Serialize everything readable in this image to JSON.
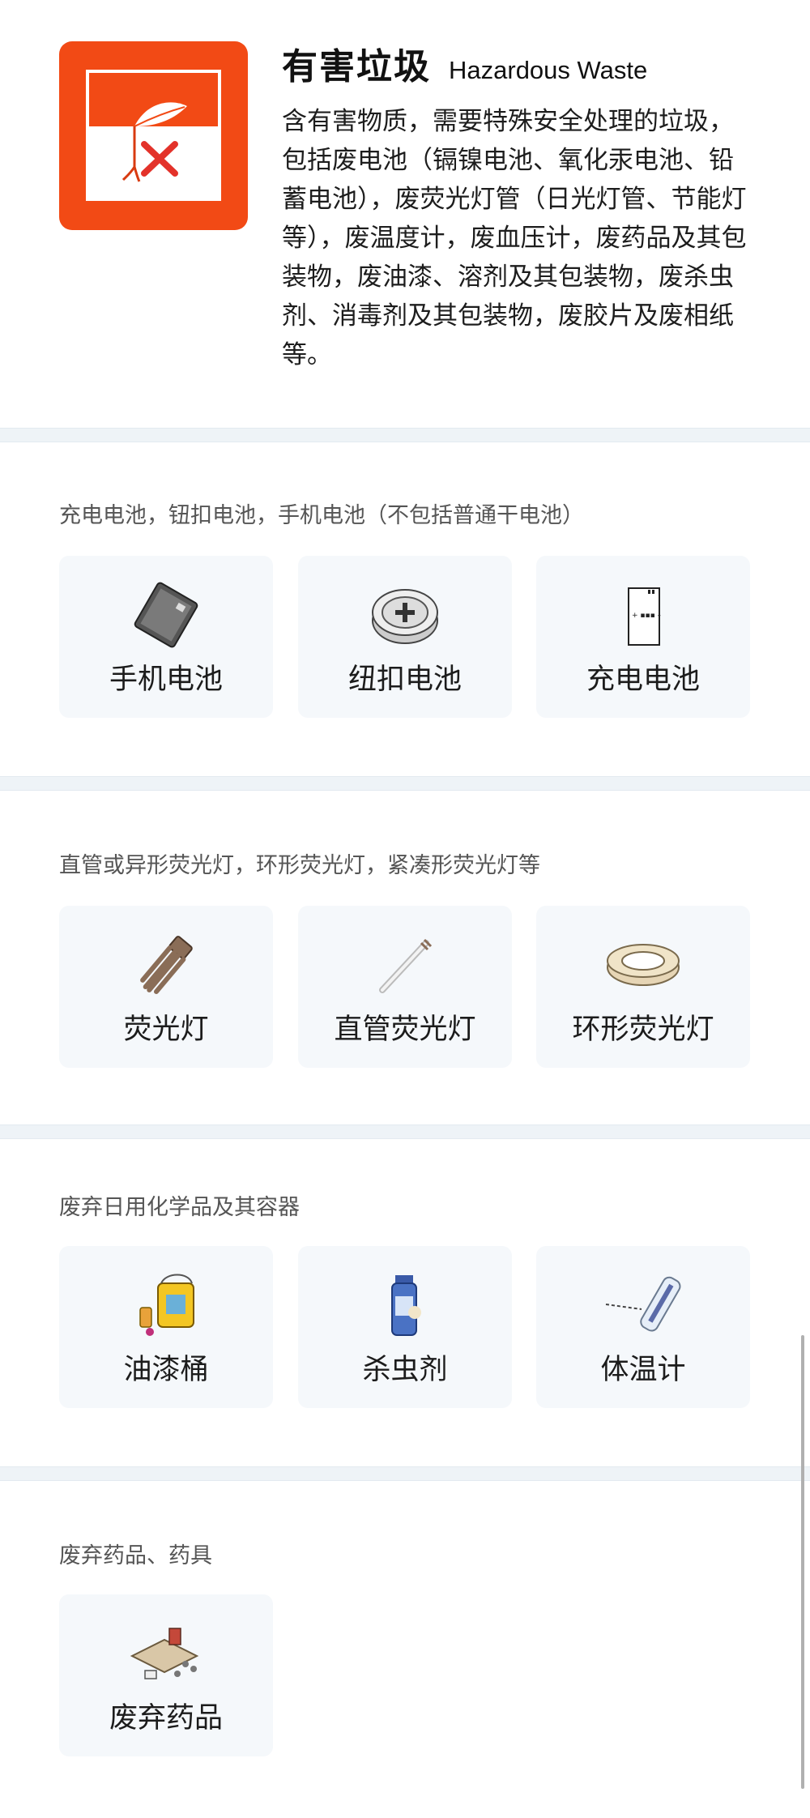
{
  "header": {
    "title_cn": "有害垃圾",
    "title_en": "Hazardous Waste",
    "description": "含有害物质，需要特殊安全处理的垃圾，包括废电池（镉镍电池、氧化汞电池、铅蓄电池），废荧光灯管（日光灯管、节能灯等），废温度计，废血压计，废药品及其包装物，废油漆、溶剂及其包装物，废杀虫剂、消毒剂及其包装物，废胶片及废相纸等。",
    "logo_color": "#f24a15"
  },
  "sections": [
    {
      "title": "充电电池，钮扣电池，手机电池（不包括普通干电池）",
      "items": [
        {
          "label": "手机电池",
          "icon": "phone-battery-icon"
        },
        {
          "label": "纽扣电池",
          "icon": "button-battery-icon"
        },
        {
          "label": "充电电池",
          "icon": "rechargeable-battery-icon"
        }
      ]
    },
    {
      "title": "直管或异形荧光灯，环形荧光灯，紧凑形荧光灯等",
      "items": [
        {
          "label": "荧光灯",
          "icon": "cfl-bulb-icon"
        },
        {
          "label": "直管荧光灯",
          "icon": "tube-lamp-icon"
        },
        {
          "label": "环形荧光灯",
          "icon": "ring-lamp-icon"
        }
      ]
    },
    {
      "title": "废弃日用化学品及其容器",
      "items": [
        {
          "label": "油漆桶",
          "icon": "paint-bucket-icon"
        },
        {
          "label": "杀虫剂",
          "icon": "insecticide-icon"
        },
        {
          "label": "体温计",
          "icon": "thermometer-icon"
        }
      ]
    },
    {
      "title": "废弃药品、药具",
      "items": [
        {
          "label": "废弃药品",
          "icon": "medicine-icon"
        }
      ]
    }
  ]
}
